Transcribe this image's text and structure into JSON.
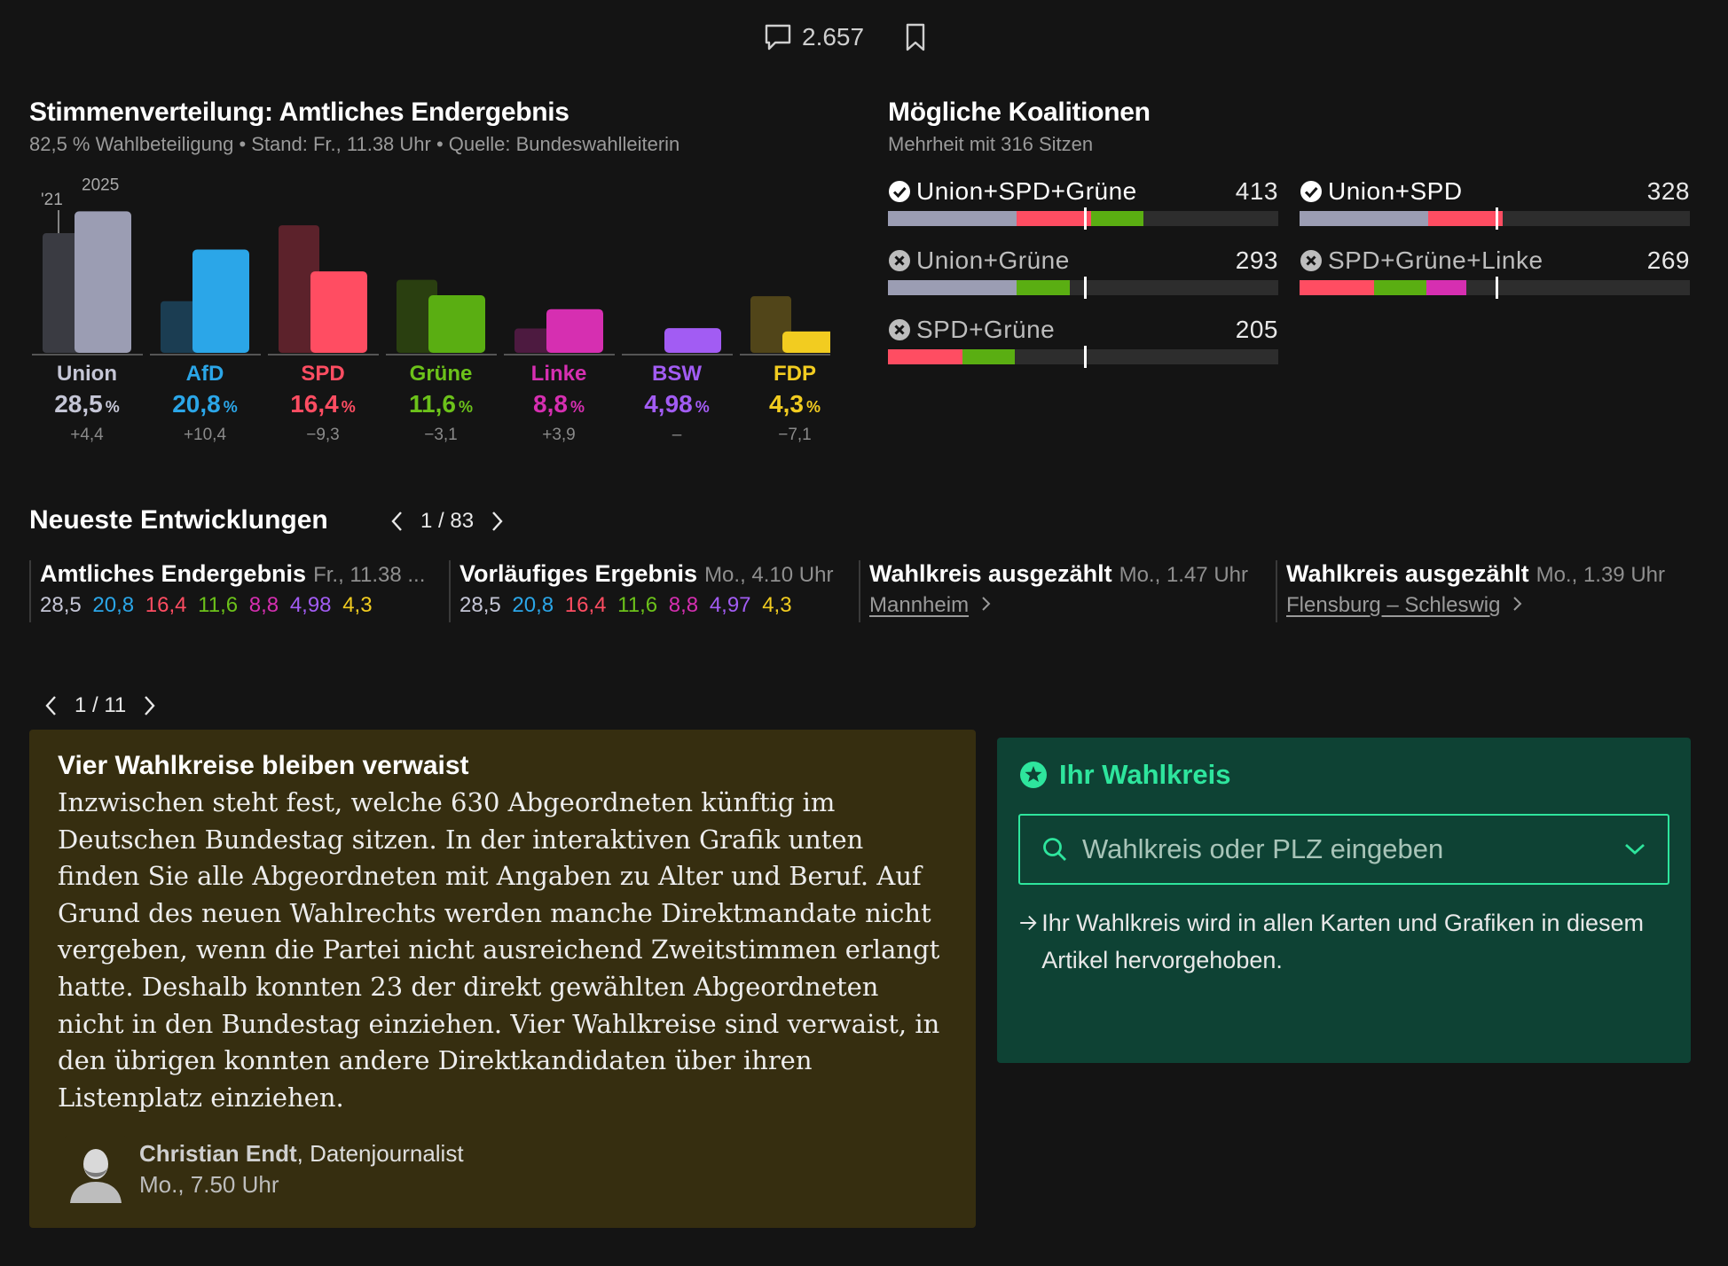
{
  "topbar": {
    "comment_count": "2.657"
  },
  "votes": {
    "title": "Stimmenverteilung: Amtliches Endergebnis",
    "subtitle": "82,5 % Wahlbeteiligung • Stand: Fr., 11.38 Uhr • Quelle: Bundeswahlleiterin",
    "label_prev": "'21",
    "label_curr": "2025"
  },
  "chart_data": {
    "type": "bar",
    "categories": [
      "Union",
      "AfD",
      "SPD",
      "Grüne",
      "Linke",
      "BSW",
      "FDP"
    ],
    "series": [
      {
        "name": "'21",
        "values": [
          24.1,
          10.4,
          25.7,
          14.7,
          4.9,
          0,
          11.4
        ]
      },
      {
        "name": "2025",
        "values": [
          28.5,
          20.8,
          16.4,
          11.6,
          8.8,
          4.98,
          4.3
        ]
      }
    ],
    "values_text": [
      "28,5",
      "20,8",
      "16,4",
      "11,6",
      "8,8",
      "4,98",
      "4,3"
    ],
    "diffs": [
      "+4,4",
      "+10,4",
      "−9,3",
      "−3,1",
      "+3,9",
      "–",
      "−7,1"
    ],
    "colors": [
      "#9b9db3",
      "#2ba6e8",
      "#ff4d62",
      "#5aae12",
      "#d62fb1",
      "#a25cf3",
      "#f2cc20"
    ],
    "colors_prev": [
      "#3a3b42",
      "#1b3d52",
      "#5c222b",
      "#2a3f10",
      "#4d1a40",
      "#3a2656",
      "#514519"
    ],
    "name_colors": [
      "#c5c6d6",
      "#2ba6e8",
      "#ff4d62",
      "#6cc21a",
      "#d62fb1",
      "#a25cf3",
      "#f2cc20"
    ],
    "ylim": [
      0,
      30
    ]
  },
  "coalitions": {
    "title": "Mögliche Koalitionen",
    "subtitle": "Mehrheit mit 316 Sitzen",
    "majority": 316,
    "scale_max": 630,
    "items": [
      {
        "label": "Union+SPD+Grüne",
        "seats": 413,
        "status": "ok",
        "segments": [
          {
            "color": "#9b9db3",
            "seats": 208
          },
          {
            "color": "#ff4d62",
            "seats": 120
          },
          {
            "color": "#5aae12",
            "seats": 85
          }
        ]
      },
      {
        "label": "Union+SPD",
        "seats": 328,
        "status": "ok",
        "segments": [
          {
            "color": "#9b9db3",
            "seats": 208
          },
          {
            "color": "#ff4d62",
            "seats": 120
          }
        ]
      },
      {
        "label": "Union+Grüne",
        "seats": 293,
        "status": "no",
        "segments": [
          {
            "color": "#9b9db3",
            "seats": 208
          },
          {
            "color": "#5aae12",
            "seats": 85
          }
        ]
      },
      {
        "label": "SPD+Grüne+Linke",
        "seats": 269,
        "status": "no",
        "segments": [
          {
            "color": "#ff4d62",
            "seats": 120
          },
          {
            "color": "#5aae12",
            "seats": 85
          },
          {
            "color": "#d62fb1",
            "seats": 64
          }
        ]
      },
      {
        "label": "SPD+Grüne",
        "seats": 205,
        "status": "no",
        "segments": [
          {
            "color": "#ff4d62",
            "seats": 120
          },
          {
            "color": "#5aae12",
            "seats": 85
          }
        ]
      }
    ]
  },
  "developments": {
    "title": "Neueste Entwicklungen",
    "pager": "1 / 83",
    "cards": [
      {
        "title": "Amtliches Endergebnis",
        "time": "Fr., 11.38 ...",
        "values": [
          "28,5",
          "20,8",
          "16,4",
          "11,6",
          "8,8",
          "4,98",
          "4,3"
        ]
      },
      {
        "title": "Vorläufiges Ergebnis",
        "time": "Mo., 4.10 Uhr",
        "values": [
          "28,5",
          "20,8",
          "16,4",
          "11,6",
          "8,8",
          "4,97",
          "4,3"
        ]
      },
      {
        "title": "Wahlkreis ausgezählt",
        "time": "Mo., 1.47 Uhr",
        "link": "Mannheim"
      },
      {
        "title": "Wahlkreis ausgezählt",
        "time": "Mo., 1.39 Uhr",
        "link": "Flensburg – Schleswig"
      }
    ]
  },
  "news": {
    "pager": "1 / 11",
    "title": "Vier Wahlkreise bleiben verwaist",
    "body": "Inzwischen steht fest, welche 630 Abgeordneten künftig im Deutschen Bundestag sitzen. In der interaktiven Grafik unten finden Sie alle Abgeordneten mit Angaben zu Alter und Beruf. Auf Grund des neuen Wahlrechts werden manche Direktmandate nicht vergeben, wenn die Partei nicht ausreichend Zweitstimmen erlangt hatte. Deshalb konnten 23 der direkt gewählten Abgeordneten nicht in den Bundestag einziehen. Vier Wahlkreise sind verwaist, in den übrigen konnten andere Direktkandidaten über ihren Listenplatz einziehen.",
    "author_name": "Christian Endt",
    "author_role": ", Datenjournalist",
    "time": "Mo., 7.50 Uhr"
  },
  "wahlkreis": {
    "title": "Ihr Wahlkreis",
    "placeholder": "Wahlkreis oder PLZ eingeben",
    "note": "Ihr Wahlkreis wird in allen Karten und Grafiken in diesem Artikel hervorgehoben."
  }
}
